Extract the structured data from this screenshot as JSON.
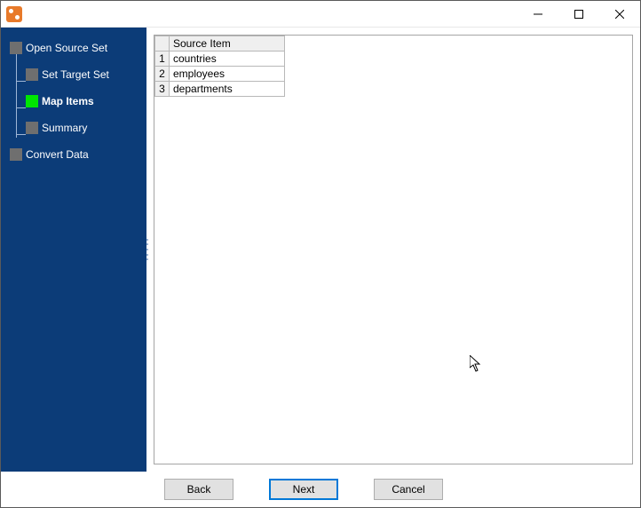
{
  "sidebar": {
    "items": [
      {
        "label": "Open Source Set",
        "child": false,
        "active": false
      },
      {
        "label": "Set Target Set",
        "child": true,
        "active": false
      },
      {
        "label": "Map Items",
        "child": true,
        "active": true
      },
      {
        "label": "Summary",
        "child": true,
        "active": false
      },
      {
        "label": "Convert Data",
        "child": false,
        "active": false
      }
    ]
  },
  "table": {
    "header": "Source Item",
    "rows": [
      {
        "n": "1",
        "item": "countries"
      },
      {
        "n": "2",
        "item": "employees"
      },
      {
        "n": "3",
        "item": "departments"
      }
    ]
  },
  "buttons": {
    "back": "Back",
    "next": "Next",
    "cancel": "Cancel"
  }
}
